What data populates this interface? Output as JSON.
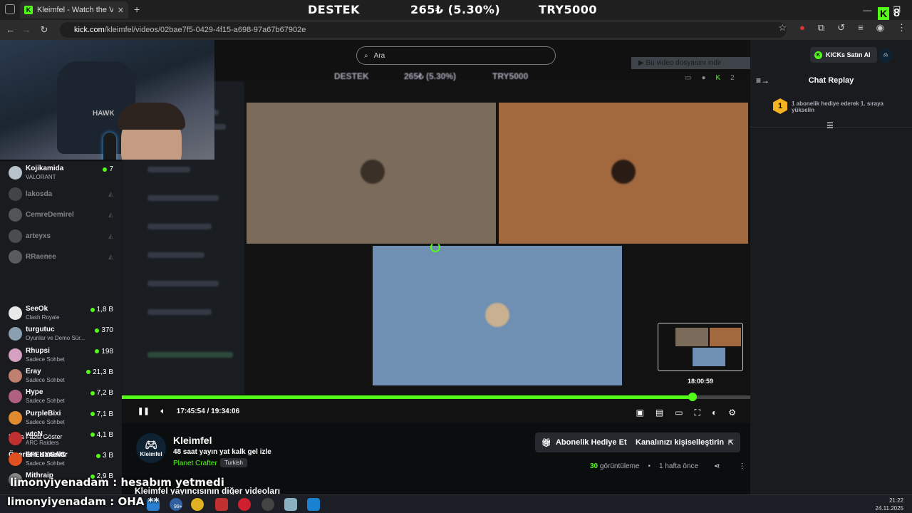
{
  "browser": {
    "tab_title": "Kleimfel - Watch the VOD on Ki",
    "url_host": "kick.com",
    "url_path": "/kleimfel/videos/02bae7f5-0429-4f15-a698-97a67b67902e"
  },
  "overlay": {
    "banner_left": "DESTEK",
    "banner_mid": "265₺ (5.30%)",
    "banner_right": "TRY5000",
    "kick_count": "8",
    "webcam_brand": "HAWK",
    "chat_line1": "limonyiyenadam : hesabım yetmedi",
    "chat_line2": "limonyiyenadam : OHA **"
  },
  "search": {
    "placeholder": "Ara"
  },
  "player": {
    "download_banner": "Bu video dosyasını indir",
    "blur_strip": [
      "DESTEK",
      "265₺ (5.30%)",
      "TRY5000"
    ],
    "thumb_time": "18:00:59",
    "current_time": "17:45:54",
    "duration": "19:34:06",
    "progress_fraction": 0.9076,
    "top_right_count": "2"
  },
  "sidebar": {
    "followed": [
      {
        "name": "Kojikamida",
        "game": "VALORANT",
        "count": "7",
        "live": true,
        "color": "#b9c3cc"
      },
      {
        "name": "lakosda",
        "live": false,
        "color": "#777"
      },
      {
        "name": "CemreDemirel",
        "live": false,
        "color": "#999"
      },
      {
        "name": "arteyxs",
        "live": false,
        "color": "#888"
      },
      {
        "name": "RRaenee",
        "live": false,
        "color": "#aaa"
      }
    ],
    "show_more": "Daha Fazla Göster",
    "recommended_heading": "Önerilen Kanallar",
    "recommended": [
      {
        "name": "SeeOk",
        "game": "Clash Royale",
        "count": "1,8 B",
        "color": "#e9e9e9"
      },
      {
        "name": "turgutuc",
        "game": "Oyunlar ve Demo Sür...",
        "count": "370",
        "color": "#8aa0b0"
      },
      {
        "name": "Rhupsi",
        "game": "Sadece Sohbet",
        "count": "198",
        "color": "#d6a0c0"
      },
      {
        "name": "Eray",
        "game": "Sadece Sohbet",
        "count": "21,3 B",
        "color": "#c08070"
      },
      {
        "name": "Hype",
        "game": "Sadece Sohbet",
        "count": "7,2 B",
        "color": "#b06080"
      },
      {
        "name": "PurpleBixi",
        "game": "Sadece Sohbet",
        "count": "7,1 B",
        "color": "#e08a30"
      },
      {
        "name": "wtcN",
        "game": "ARC Raiders",
        "count": "4,1 B",
        "color": "#c03030"
      },
      {
        "name": "EFEUYGAC",
        "game": "Sadece Sohbet",
        "count": "3 B",
        "color": "#e05020"
      },
      {
        "name": "Mithraip",
        "game": "",
        "count": "2,9 B",
        "color": "#888"
      }
    ]
  },
  "channel": {
    "name": "Kleimfel",
    "avatar_text": "Kleimfel",
    "title": "48 saat yayın yat kalk gel izle",
    "category": "Planet Crafter",
    "language": "Turkish",
    "gift_button": "Abonelik Hediye Et",
    "customize_button": "Kanalınızı kişiselleştirin",
    "views_count": "30",
    "views_label": "görüntüleme",
    "time_ago": "1 hafta önce",
    "more_videos_heading": "Kleimfel yayıncısının diğer videoları"
  },
  "chat": {
    "kicks_button": "KICKs Satın Al",
    "title": "Chat Replay",
    "pinned_rank": "1",
    "pinned_text": "1 abonelik hediye ederek 1. sıraya yükselin"
  },
  "taskbar": {
    "time": "21:22",
    "date": "24.11.2025",
    "badge": "99+"
  },
  "colors": {
    "accent": "#53fc18",
    "bg": "#0b0e0f",
    "panel": "#191b1f"
  }
}
